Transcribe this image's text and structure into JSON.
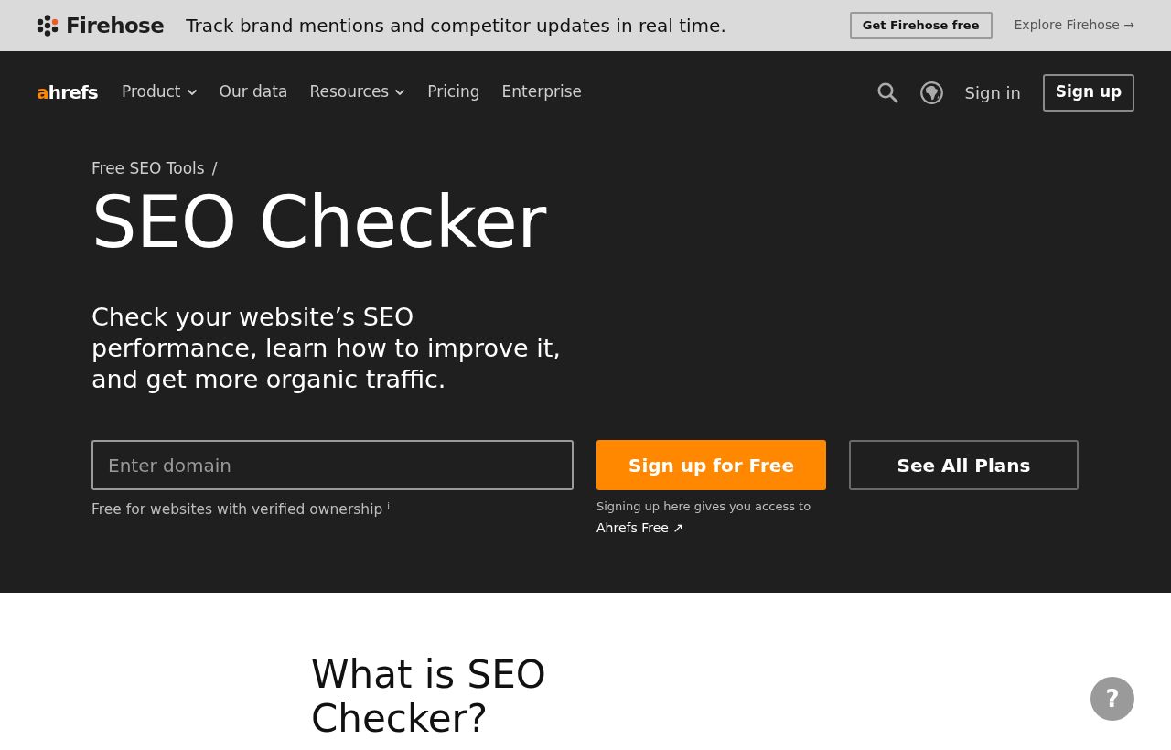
{
  "promo_bar": {
    "brand": "Firehose",
    "message": "Track brand mentions and competitor updates in real time.",
    "cta": "Get Firehose free",
    "link": "Explore Firehose →"
  },
  "navbar": {
    "logo_accent": "a",
    "logo_rest": "hrefs",
    "items": [
      {
        "label": "Product",
        "has_menu": true
      },
      {
        "label": "Our data",
        "has_menu": false
      },
      {
        "label": "Resources",
        "has_menu": true
      },
      {
        "label": "Pricing",
        "has_menu": false
      },
      {
        "label": "Enterprise",
        "has_menu": false
      }
    ],
    "sign_in": "Sign in",
    "sign_up": "Sign up"
  },
  "hero": {
    "breadcrumb": "Free SEO Tools",
    "breadcrumb_separator": "/",
    "title": "SEO Checker",
    "subtitle": "Check your website’s SEO performance, learn how to improve it, and get more organic traffic.",
    "domain_field": {
      "placeholder": "Enter domain"
    },
    "field_note": "Free for websites with verified ownership $^{i}$",
    "primary_button": "Sign up for Free",
    "signup_note": "Signing up here gives you access to",
    "signup_link": "Ahrefs Free ↗",
    "secondary_button": "See All Plans"
  },
  "section": {
    "heading": "What is SEO Checker?"
  },
  "help_button": "?"
}
